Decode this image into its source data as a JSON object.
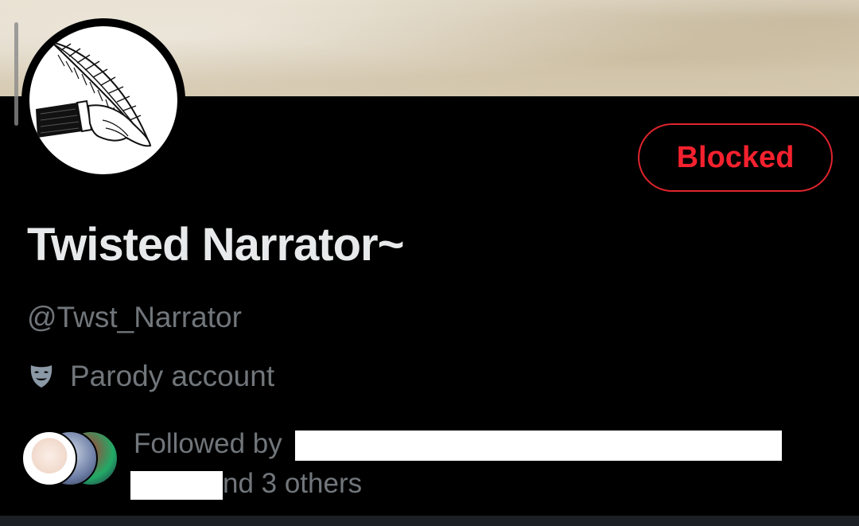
{
  "profile": {
    "display_name": "Twisted Narrator~",
    "handle": "@Twst_Narrator",
    "label": "Parody account"
  },
  "actions": {
    "blocked_label": "Blocked"
  },
  "followed_by": {
    "prefix": "Followed by",
    "suffix": "nd 3 others"
  },
  "icons": {
    "label_icon": "theater-mask-icon",
    "avatar_icon": "quill-hand-icon"
  },
  "colors": {
    "background": "#000000",
    "blocked_red": "#f4212e",
    "primary_text": "#e7e9ea",
    "secondary_text": "#71767b"
  }
}
